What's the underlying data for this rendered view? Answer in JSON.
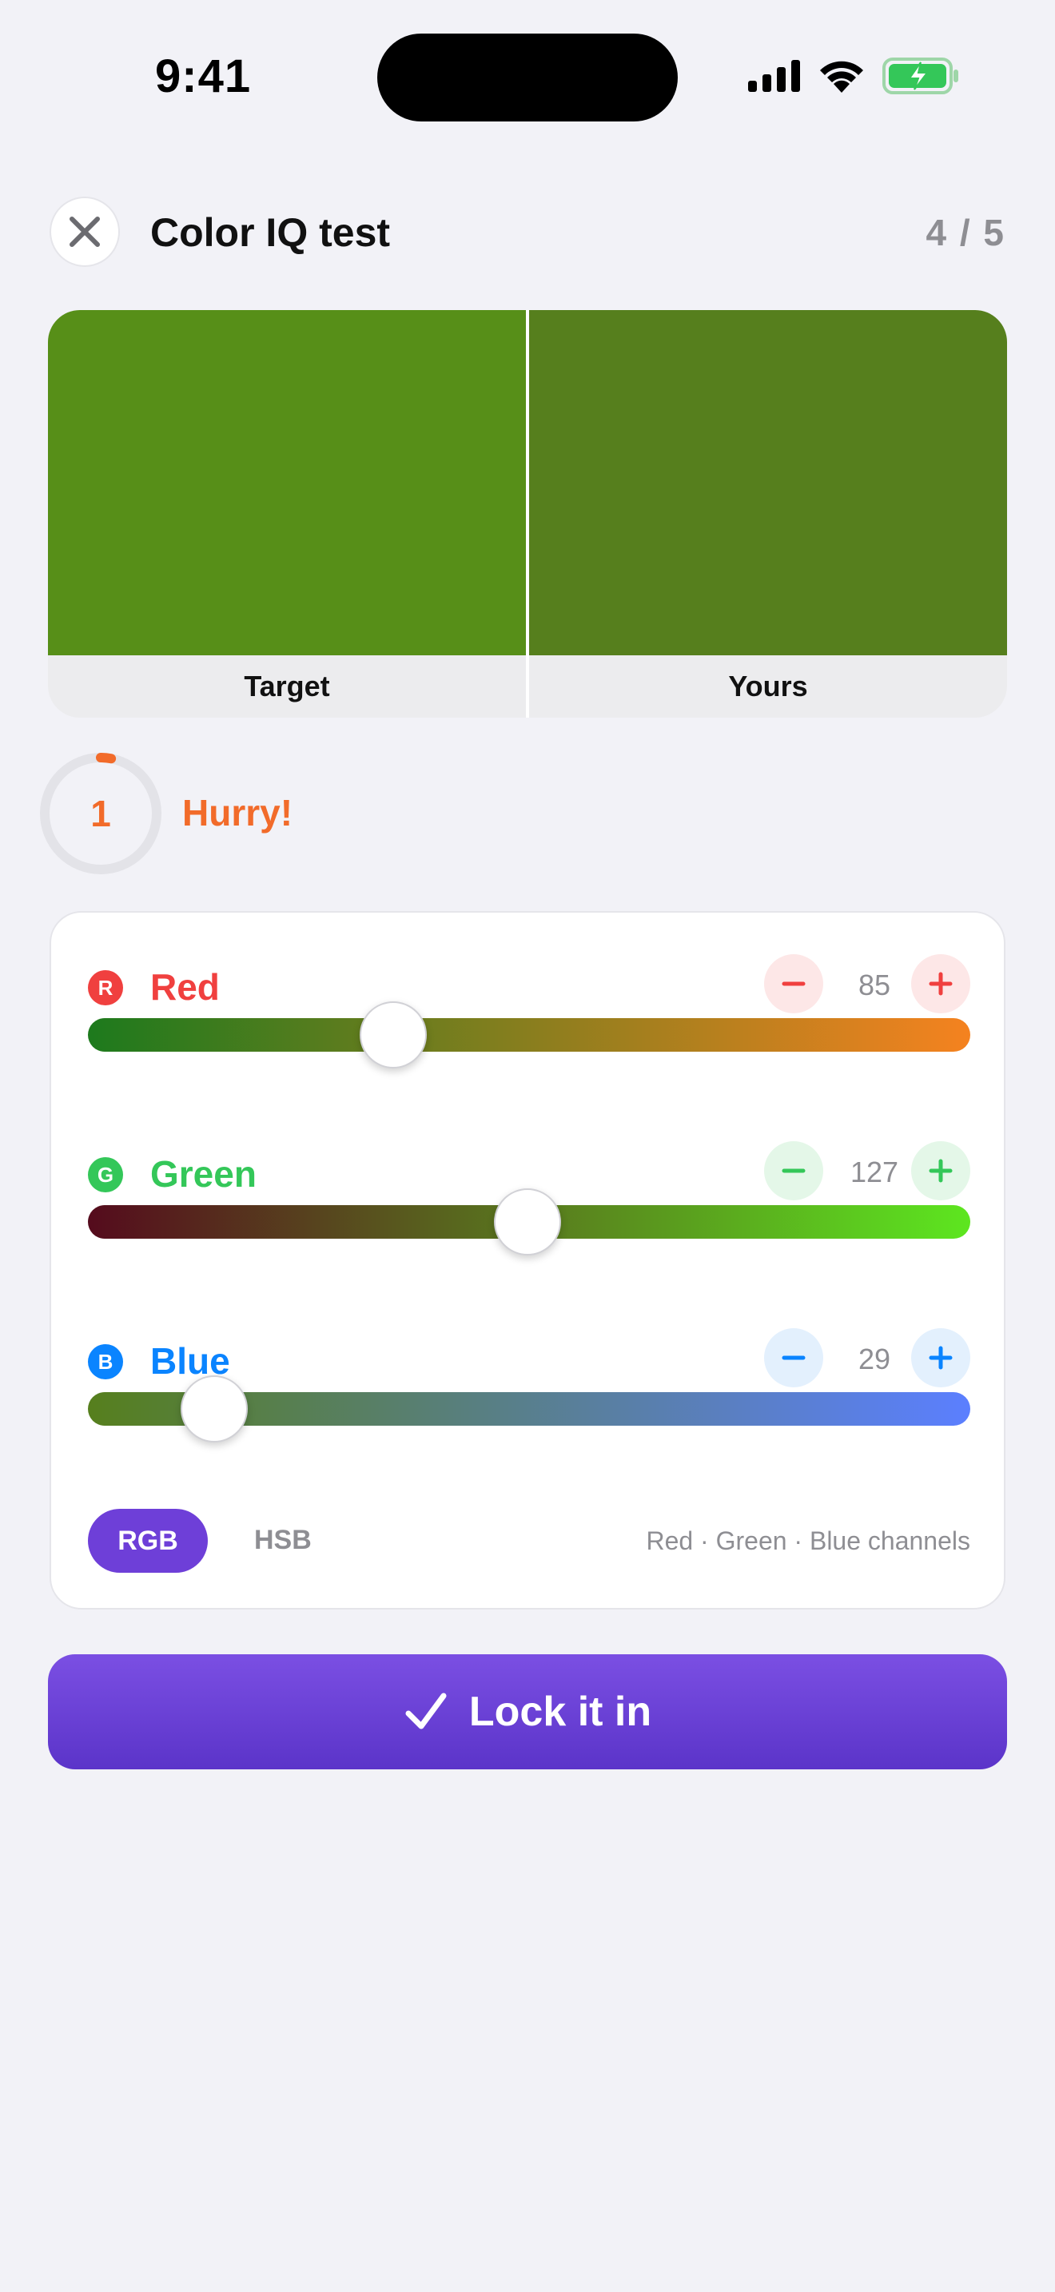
{
  "status_bar": {
    "time": "9:41"
  },
  "header": {
    "title": "Color IQ test",
    "progress": "4 / 5"
  },
  "swatches": {
    "target_label": "Target",
    "yours_label": "Yours",
    "target_color": "#578f18",
    "yours_color": "#567f1d"
  },
  "timer": {
    "seconds_left": "1",
    "message": "Hurry!",
    "remaining_fraction": 0.03,
    "color": "#f26b2a"
  },
  "channels": [
    {
      "badge": "R",
      "name": "Red",
      "value": "85",
      "max": 255,
      "color": "#f0403f",
      "soft": "#fde7e7",
      "track_from": "#1d7a1d",
      "track_to": "#f5821f"
    },
    {
      "badge": "G",
      "name": "Green",
      "value": "127",
      "max": 255,
      "color": "#34c759",
      "soft": "#e4f7e8",
      "track_from": "#550b1d",
      "track_to": "#5de61f"
    },
    {
      "badge": "B",
      "name": "Blue",
      "value": "29",
      "max": 255,
      "color": "#0a84ff",
      "soft": "#e3f0fd",
      "track_from": "#567f1d",
      "track_to": "#5b7fff"
    }
  ],
  "mode": {
    "active": "RGB",
    "inactive": "HSB",
    "description": "Red · Green · Blue channels"
  },
  "cta": {
    "label": "Lock it in"
  },
  "colors": {
    "accent": "#6e3fd8",
    "background": "#f2f2f7"
  }
}
